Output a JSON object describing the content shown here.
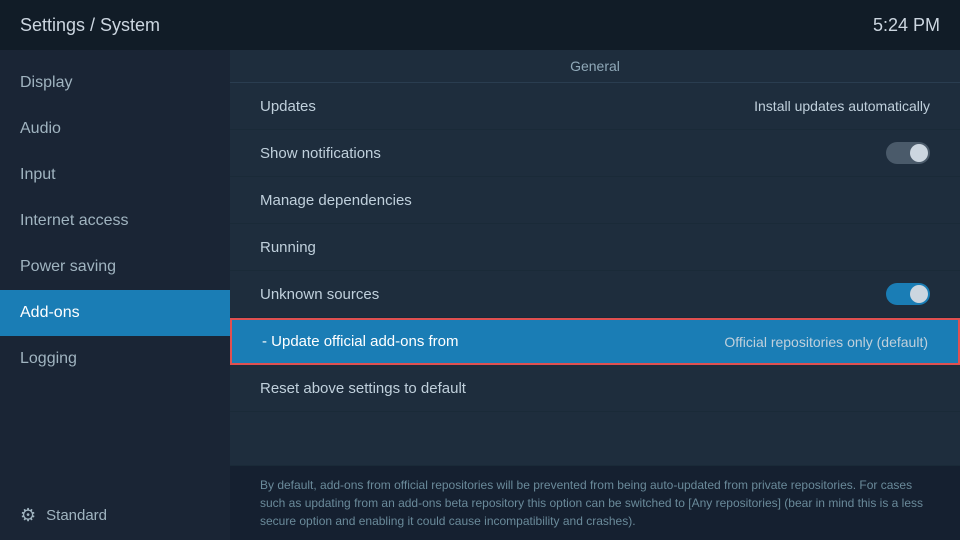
{
  "header": {
    "title": "Settings / System",
    "time": "5:24 PM"
  },
  "sidebar": {
    "items": [
      {
        "id": "display",
        "label": "Display",
        "active": false
      },
      {
        "id": "audio",
        "label": "Audio",
        "active": false
      },
      {
        "id": "input",
        "label": "Input",
        "active": false
      },
      {
        "id": "internet-access",
        "label": "Internet access",
        "active": false
      },
      {
        "id": "power-saving",
        "label": "Power saving",
        "active": false
      },
      {
        "id": "add-ons",
        "label": "Add-ons",
        "active": true
      },
      {
        "id": "logging",
        "label": "Logging",
        "active": false
      }
    ],
    "bottom_label": "Standard"
  },
  "main": {
    "section_header": "General",
    "settings": [
      {
        "id": "updates",
        "label": "Updates",
        "value": "Install updates automatically",
        "toggle": null,
        "highlighted": false
      },
      {
        "id": "show-notifications",
        "label": "Show notifications",
        "value": null,
        "toggle": "off",
        "highlighted": false
      },
      {
        "id": "manage-dependencies",
        "label": "Manage dependencies",
        "value": null,
        "toggle": null,
        "highlighted": false
      },
      {
        "id": "running",
        "label": "Running",
        "value": null,
        "toggle": null,
        "highlighted": false
      },
      {
        "id": "unknown-sources",
        "label": "Unknown sources",
        "value": null,
        "toggle": "on",
        "highlighted": false
      },
      {
        "id": "update-official-add-ons",
        "label": "- Update official add-ons from",
        "value": "Official repositories only (default)",
        "toggle": null,
        "highlighted": true
      },
      {
        "id": "reset-settings",
        "label": "Reset above settings to default",
        "value": null,
        "toggle": null,
        "highlighted": false
      }
    ],
    "footer_text": "By default, add-ons from official repositories will be prevented from being auto-updated from private repositories. For cases such as updating from an add-ons beta repository this option can be switched to [Any repositories] (bear in mind this is a less secure option and enabling it could cause incompatibility and crashes)."
  }
}
